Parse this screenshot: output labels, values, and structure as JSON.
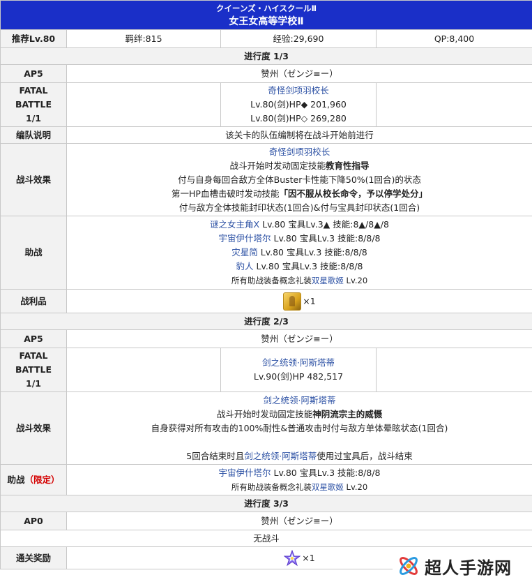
{
  "title_jp": "クイーンズ・ハイスクールⅡ",
  "title_cn": "女王女高等学校Ⅱ",
  "summary": {
    "level": "推荐Lv.80",
    "bond": "羁绊:815",
    "exp": "经验:29,690",
    "qp": "QP:8,400"
  },
  "labels": {
    "ap": "AP5",
    "ap0": "AP0",
    "fatal_battle": "FATAL\nBATTLE\n1/1",
    "fatal": "FATAL",
    "battle": "BATTLE",
    "battle_count": "1/1",
    "formation": "编队说明",
    "effect": "战斗效果",
    "support": "助战",
    "support_limited": "（限定）",
    "drops": "战利品",
    "clear_reward": "通关奖励"
  },
  "progress1": {
    "header": "进行度 1/3",
    "ap_value": "赞州（ゼンジ≡ー）",
    "enemy_name": "奇怪剑项羽校长",
    "enemy_hp1": "Lv.80(剑)HP◆ 201,960",
    "enemy_hp2": "Lv.80(剑)HP◇ 269,280",
    "formation_text": "该关卡的队伍编制将在战斗开始前进行",
    "effect_name": "奇怪剑项羽校长",
    "effect_line1_pre": "战斗开始时发动固定技能",
    "effect_line1_bold": "教育性指导",
    "effect_line2": "付与自身每回合敌方全体Buster卡性能下降50%(1回合)的状态",
    "effect_line3_pre": "第一HP血槽击破时发动技能",
    "effect_line3_bold": "「因不服从校长命令，予以停学处分」",
    "effect_line4": "付与敌方全体技能封印状态(1回合)&付与宝具封印状态(1回合)",
    "support": [
      {
        "name": "谜之女主角X",
        "detail": " Lv.80 宝具Lv.3▲ 技能:8▲/8▲/8"
      },
      {
        "name": "宇宙伊什塔尔",
        "detail": " Lv.80 宝具Lv.3 技能:8/8/8"
      },
      {
        "name": "灾星简",
        "detail": " Lv.80 宝具Lv.3 技能:8/8/8"
      },
      {
        "name": "豹人",
        "detail": " Lv.80 宝具Lv.3 技能:8/8/8"
      }
    ],
    "support_ce_pre": "所有助战装备概念礼装",
    "support_ce_name": "双星歌姬",
    "support_ce_lv": " Lv.20",
    "drop_count": "×1"
  },
  "progress2": {
    "header": "进行度 2/3",
    "ap_value": "赞州（ゼンジ≡ー）",
    "enemy_name": "剑之统领·阿斯塔蒂",
    "enemy_hp": "Lv.90(剑)HP 482,517",
    "effect_name": "剑之统领·阿斯塔蒂",
    "effect_line1_pre": "战斗开始时发动固定技能",
    "effect_line1_bold": "神阴流宗主的威慑",
    "effect_line2": "自身获得对所有攻击的100%耐性&普通攻击时付与敌方单体晕眩状态(1回合)",
    "effect_line3_pre": "5回合结束时且",
    "effect_line3_name": "剑之统领·阿斯塔蒂",
    "effect_line3_post": "使用过宝具后，战斗结束",
    "support_name": "宇宙伊什塔尔",
    "support_detail": " Lv.80 宝具Lv.3 技能:8/8/8",
    "support_ce_pre": "所有助战装备概念礼装",
    "support_ce_name": "双星歌姬",
    "support_ce_lv": " Lv.20"
  },
  "progress3": {
    "header": "进行度 3/3",
    "ap_value": "赞州（ゼンジ≡ー）",
    "no_battle": "无战斗",
    "reward_count": "×1"
  },
  "watermark": {
    "text": "超人手游网"
  },
  "colors": {
    "title_bg": "#1a2fc8",
    "link": "#2a4fa3",
    "limited": "#d40000",
    "header_bg": "#f2f2f2"
  }
}
